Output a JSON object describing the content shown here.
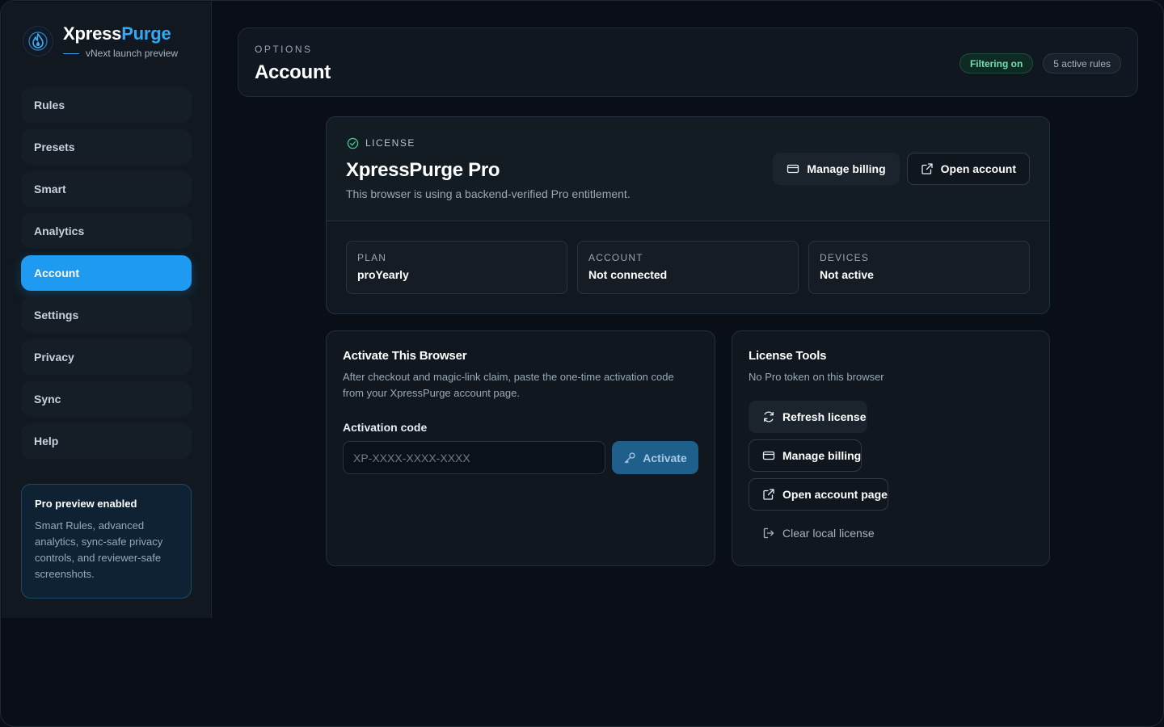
{
  "brand": {
    "name_part1": "Xpress",
    "name_part2": "Purge",
    "subtitle": "vNext launch preview",
    "logo_icon": "flame-drop-icon",
    "accent_color": "#35a8f4"
  },
  "sidebar": {
    "items": [
      {
        "label": "Rules"
      },
      {
        "label": "Presets"
      },
      {
        "label": "Smart"
      },
      {
        "label": "Analytics"
      },
      {
        "label": "Account",
        "active": true
      },
      {
        "label": "Settings"
      },
      {
        "label": "Privacy"
      },
      {
        "label": "Sync"
      },
      {
        "label": "Help"
      }
    ],
    "promo": {
      "title": "Pro preview enabled",
      "text": "Smart Rules, advanced analytics, sync-safe privacy controls, and reviewer-safe screenshots."
    }
  },
  "header": {
    "eyebrow": "OPTIONS",
    "title": "Account",
    "status_pill": "Filtering on",
    "rules_pill": "5 active rules"
  },
  "license": {
    "eyebrow": "LICENSE",
    "title": "XpressPurge Pro",
    "description": "This browser is using a backend-verified Pro entitlement.",
    "manage_billing_label": "Manage billing",
    "open_account_label": "Open account",
    "stats": [
      {
        "label": "PLAN",
        "value": "proYearly"
      },
      {
        "label": "ACCOUNT",
        "value": "Not connected"
      },
      {
        "label": "DEVICES",
        "value": "Not active"
      }
    ]
  },
  "activate": {
    "title": "Activate This Browser",
    "description": "After checkout and magic-link claim, paste the one-time activation code from your XpressPurge account page.",
    "field_label": "Activation code",
    "input_value": "",
    "input_placeholder": "XP-XXXX-XXXX-XXXX",
    "button_label": "Activate"
  },
  "tools": {
    "title": "License Tools",
    "description": "No Pro token on this browser",
    "refresh_label": "Refresh license",
    "billing_label": "Manage billing",
    "account_page_label": "Open account page",
    "clear_label": "Clear local license"
  },
  "colors": {
    "background": "#0a0f17",
    "active_nav": "#1e9bf0",
    "success": "#6fe0b0",
    "activate_button": "#1f5f8c"
  }
}
